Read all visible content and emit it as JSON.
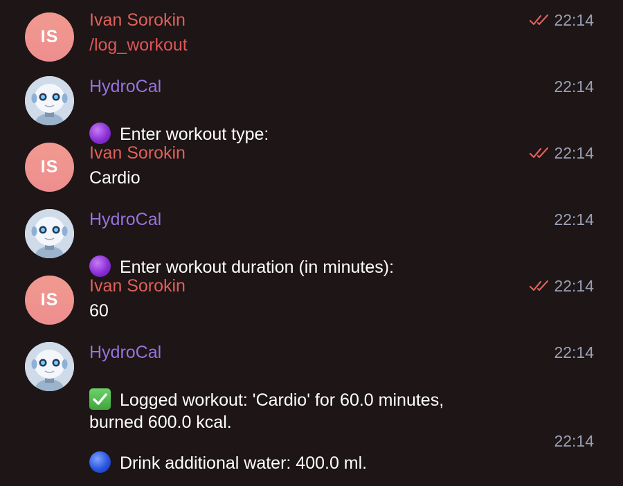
{
  "messages": [
    {
      "type": "user",
      "initials": "IS",
      "sender": "Ivan Sorokin",
      "text": "/log_workout",
      "time": "22:14",
      "read": true
    },
    {
      "type": "bot",
      "sender": "HydroCal",
      "text": "Enter workout type:",
      "icon": "purple-circle-emoji",
      "time": "22:14"
    },
    {
      "type": "user",
      "initials": "IS",
      "sender": "Ivan Sorokin",
      "text": "Cardio",
      "time": "22:14",
      "read": true
    },
    {
      "type": "bot",
      "sender": "HydroCal",
      "text": "Enter workout duration (in minutes):",
      "icon": "purple-circle-emoji",
      "time": "22:14"
    },
    {
      "type": "user",
      "initials": "IS",
      "sender": "Ivan Sorokin",
      "text": "60",
      "time": "22:14",
      "read": true
    },
    {
      "type": "bot",
      "sender": "HydroCal",
      "text": "Logged workout: 'Cardio' for 60.0 minutes,\nburned 600.0 kcal.",
      "icon": "check-mark-emoji",
      "time": "22:14"
    },
    {
      "type": "bot-continued",
      "text": "Drink additional water: 400.0 ml.",
      "icon": "blue-circle-emoji",
      "time": "22:14"
    }
  ],
  "colors": {
    "background": "#1d1516",
    "user_name": "#e0605a",
    "bot_name": "#9a72e0",
    "time": "#9ba2b5",
    "read_checks": "#e0605a"
  }
}
